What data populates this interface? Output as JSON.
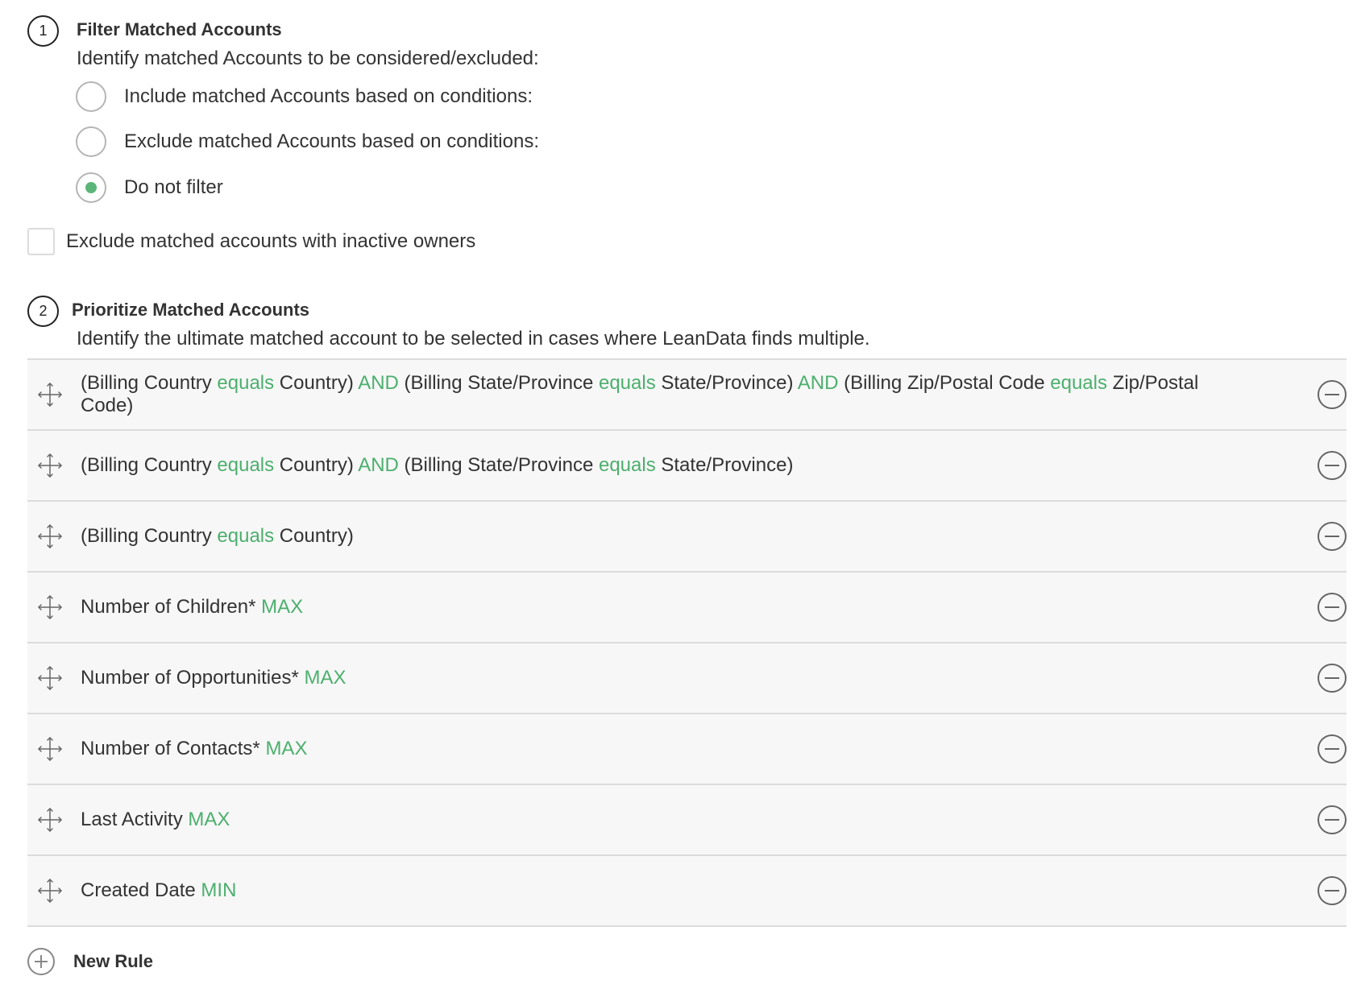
{
  "step1": {
    "number": "1",
    "title": "Filter Matched Accounts",
    "description": "Identify matched Accounts to be considered/excluded:",
    "options": [
      {
        "label": "Include matched Accounts based on conditions:",
        "checked": false
      },
      {
        "label": "Exclude matched Accounts based on conditions:",
        "checked": false
      },
      {
        "label": "Do not filter",
        "checked": true
      }
    ],
    "inactive_owner_checkbox": {
      "label": "Exclude matched accounts with inactive owners",
      "checked": false
    }
  },
  "step2": {
    "number": "2",
    "title": "Prioritize Matched Accounts",
    "description": "Identify the ultimate matched account to be selected in cases where LeanData finds multiple.",
    "rules": [
      {
        "segments": [
          {
            "text": "(Billing Country ",
            "kw": false
          },
          {
            "text": "equals",
            "kw": true
          },
          {
            "text": " Country) ",
            "kw": false
          },
          {
            "text": "AND",
            "kw": true
          },
          {
            "text": " (Billing State/Province ",
            "kw": false
          },
          {
            "text": "equals",
            "kw": true
          },
          {
            "text": " State/Province) ",
            "kw": false
          },
          {
            "text": "AND",
            "kw": true
          },
          {
            "text": " (Billing Zip/Postal Code ",
            "kw": false
          },
          {
            "text": "equals",
            "kw": true
          },
          {
            "text": " Zip/Postal Code)",
            "kw": false
          }
        ]
      },
      {
        "segments": [
          {
            "text": "(Billing Country ",
            "kw": false
          },
          {
            "text": "equals",
            "kw": true
          },
          {
            "text": " Country) ",
            "kw": false
          },
          {
            "text": "AND",
            "kw": true
          },
          {
            "text": " (Billing State/Province ",
            "kw": false
          },
          {
            "text": "equals",
            "kw": true
          },
          {
            "text": " State/Province)",
            "kw": false
          }
        ]
      },
      {
        "segments": [
          {
            "text": "(Billing Country ",
            "kw": false
          },
          {
            "text": "equals",
            "kw": true
          },
          {
            "text": " Country)",
            "kw": false
          }
        ]
      },
      {
        "segments": [
          {
            "text": "Number of Children* ",
            "kw": false
          },
          {
            "text": "MAX",
            "kw": true
          }
        ]
      },
      {
        "segments": [
          {
            "text": "Number of Opportunities* ",
            "kw": false
          },
          {
            "text": "MAX",
            "kw": true
          }
        ]
      },
      {
        "segments": [
          {
            "text": "Number of Contacts* ",
            "kw": false
          },
          {
            "text": "MAX",
            "kw": true
          }
        ]
      },
      {
        "segments": [
          {
            "text": "Last Activity ",
            "kw": false
          },
          {
            "text": "MAX",
            "kw": true
          }
        ]
      },
      {
        "segments": [
          {
            "text": "Created Date ",
            "kw": false
          },
          {
            "text": "MIN",
            "kw": true
          }
        ]
      }
    ],
    "new_rule_label": "New Rule"
  },
  "icons": {
    "drag": "move-arrows-icon",
    "remove": "minus-circle-icon",
    "add": "plus-circle-icon"
  },
  "colors": {
    "keyword": "#4caf6e",
    "radio_selected": "#5cb578"
  }
}
